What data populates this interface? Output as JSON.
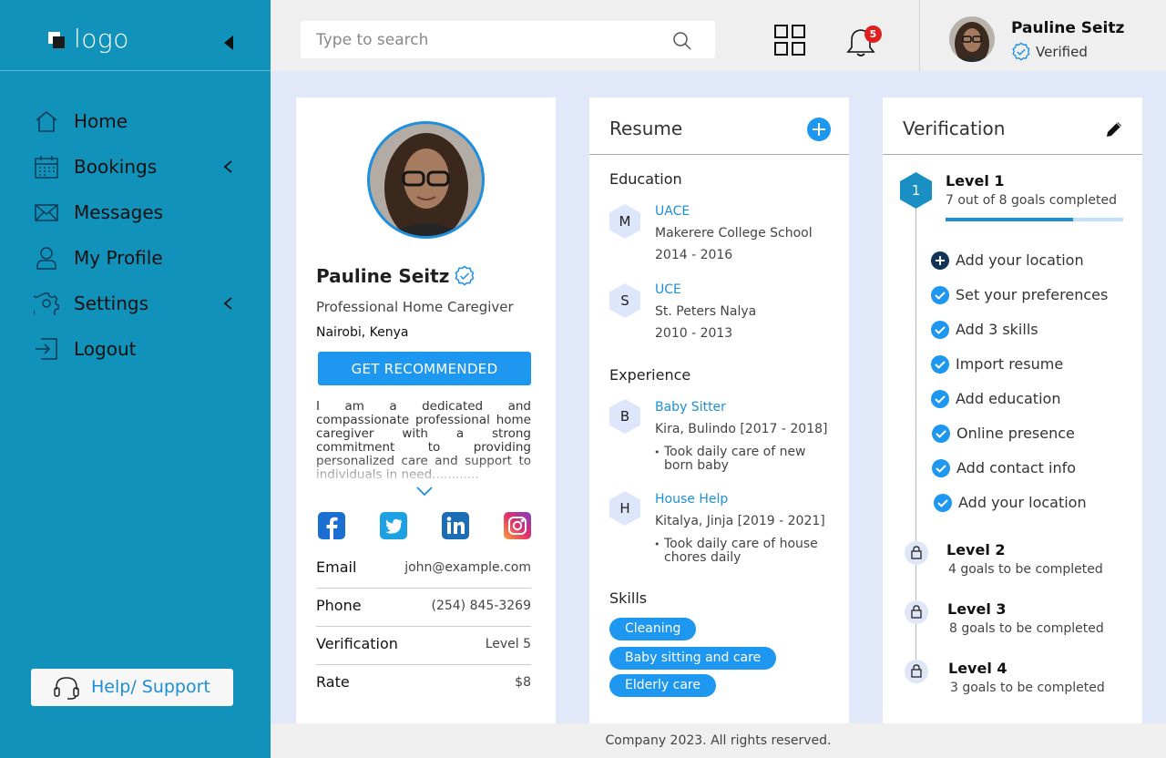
{
  "brand": {
    "logo_text": "logo"
  },
  "sidebar": {
    "items": [
      {
        "label": "Home",
        "icon": "home-icon"
      },
      {
        "label": "Bookings",
        "icon": "calendar-icon",
        "has_submenu": true
      },
      {
        "label": "Messages",
        "icon": "mail-icon"
      },
      {
        "label": "My Profile",
        "icon": "user-icon"
      },
      {
        "label": "Settings",
        "icon": "gear-icon",
        "has_submenu": true
      },
      {
        "label": "Logout",
        "icon": "logout-icon"
      }
    ],
    "help_label": "Help/ Support"
  },
  "topbar": {
    "search_placeholder": "Type to search",
    "notification_count": "5",
    "user_name": "Pauline Seitz",
    "user_status": "Verified"
  },
  "profile": {
    "name": "Pauline Seitz",
    "title": "Professional Home Caregiver",
    "location": "Nairobi, Kenya",
    "cta_label": "GET RECOMMENDED",
    "bio": "I am a dedicated and compassionate professional home caregiver with a strong commitment to providing personalized care and support to individuals in need............",
    "socials": [
      "facebook-icon",
      "twitter-icon",
      "linkedin-icon",
      "instagram-icon"
    ],
    "details": [
      {
        "key": "Email",
        "value": "john@example.com"
      },
      {
        "key": "Phone",
        "value": "(254) 845-3269"
      },
      {
        "key": "Verification",
        "value": "Level 5"
      },
      {
        "key": "Rate",
        "value": "$8"
      }
    ]
  },
  "resume": {
    "title": "Resume",
    "education_title": "Education",
    "education": [
      {
        "badge": "M",
        "name": "UACE",
        "school": "Makerere College School",
        "years": "2014 - 2016"
      },
      {
        "badge": "S",
        "name": "UCE",
        "school": "St. Peters Nalya",
        "years": "2010 - 2013"
      }
    ],
    "experience_title": "Experience",
    "experience": [
      {
        "badge": "B",
        "role": "Baby Sitter",
        "place": "Kira, Bulindo [2017 - 2018]",
        "detail": "Took daily care of new born baby"
      },
      {
        "badge": "H",
        "role": "House Help",
        "place": "Kitalya, Jinja [2019 - 2021]",
        "detail": "Took daily care of house chores daily"
      }
    ],
    "skills_title": "Skills",
    "skills": [
      "Cleaning",
      "Baby sitting and care",
      "Elderly care"
    ]
  },
  "verification": {
    "title": "Verification",
    "current_level": {
      "badge": "1",
      "name": "Level 1",
      "status": "7 out of 8 goals completed",
      "progress": 0.72
    },
    "goals": [
      {
        "label": "Add your location",
        "done": false
      },
      {
        "label": "Set your preferences",
        "done": true
      },
      {
        "label": "Add 3 skills",
        "done": true
      },
      {
        "label": "Import resume",
        "done": true
      },
      {
        "label": "Add education",
        "done": true
      },
      {
        "label": "Online presence",
        "done": true
      },
      {
        "label": "Add contact info",
        "done": true
      },
      {
        "label": "Add your location",
        "done": true
      }
    ],
    "locked_levels": [
      {
        "name": "Level 2",
        "status": "4 goals to be completed"
      },
      {
        "name": "Level 3",
        "status": "8 goals to be completed"
      },
      {
        "name": "Level 4",
        "status": "3 goals to be completed"
      }
    ]
  },
  "footer": {
    "text": "Company 2023. All rights reserved."
  },
  "colors": {
    "sidebar": "#1192ba",
    "accent": "#1d97ef",
    "content_bg": "#e0e8fa"
  }
}
